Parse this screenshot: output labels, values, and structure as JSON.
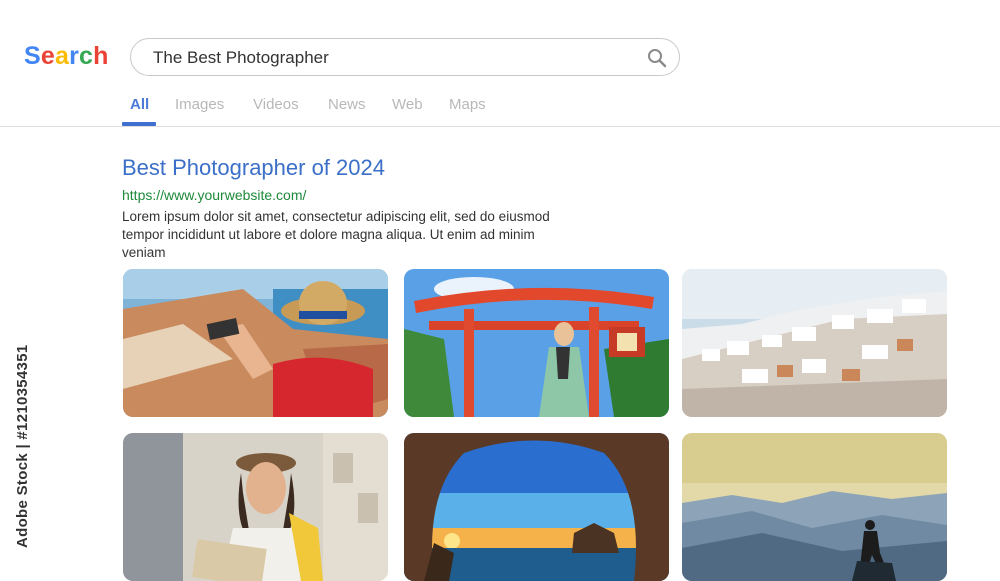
{
  "logo": {
    "letters": [
      {
        "char": "S",
        "color": "#4285F4"
      },
      {
        "char": "e",
        "color": "#EA4335"
      },
      {
        "char": "a",
        "color": "#FBBC05"
      },
      {
        "char": "r",
        "color": "#4285F4"
      },
      {
        "char": "c",
        "color": "#34A853"
      },
      {
        "char": "h",
        "color": "#EA4335"
      }
    ]
  },
  "search": {
    "query": "The Best Photographer",
    "icon": "search-icon"
  },
  "tabs": [
    {
      "label": "All",
      "active": true
    },
    {
      "label": "Images",
      "active": false
    },
    {
      "label": "Videos",
      "active": false
    },
    {
      "label": "News",
      "active": false
    },
    {
      "label": "Web",
      "active": false
    },
    {
      "label": "Maps",
      "active": false
    }
  ],
  "result": {
    "title": "Best Photographer of 2024",
    "url": "https://www.yourwebsite.com/",
    "snippet": "Lorem ipsum dolor sit amet, consectetur adipiscing elit, sed do eiusmod tempor incididunt ut labore et dolore magna aliqua. Ut enim ad minim veniam"
  },
  "watermark": "Adobe Stock | #1210354351",
  "colors": {
    "accent": "#3b6fc8",
    "url_green": "#1e8a3a",
    "tab_inactive": "#b8b8b8"
  }
}
